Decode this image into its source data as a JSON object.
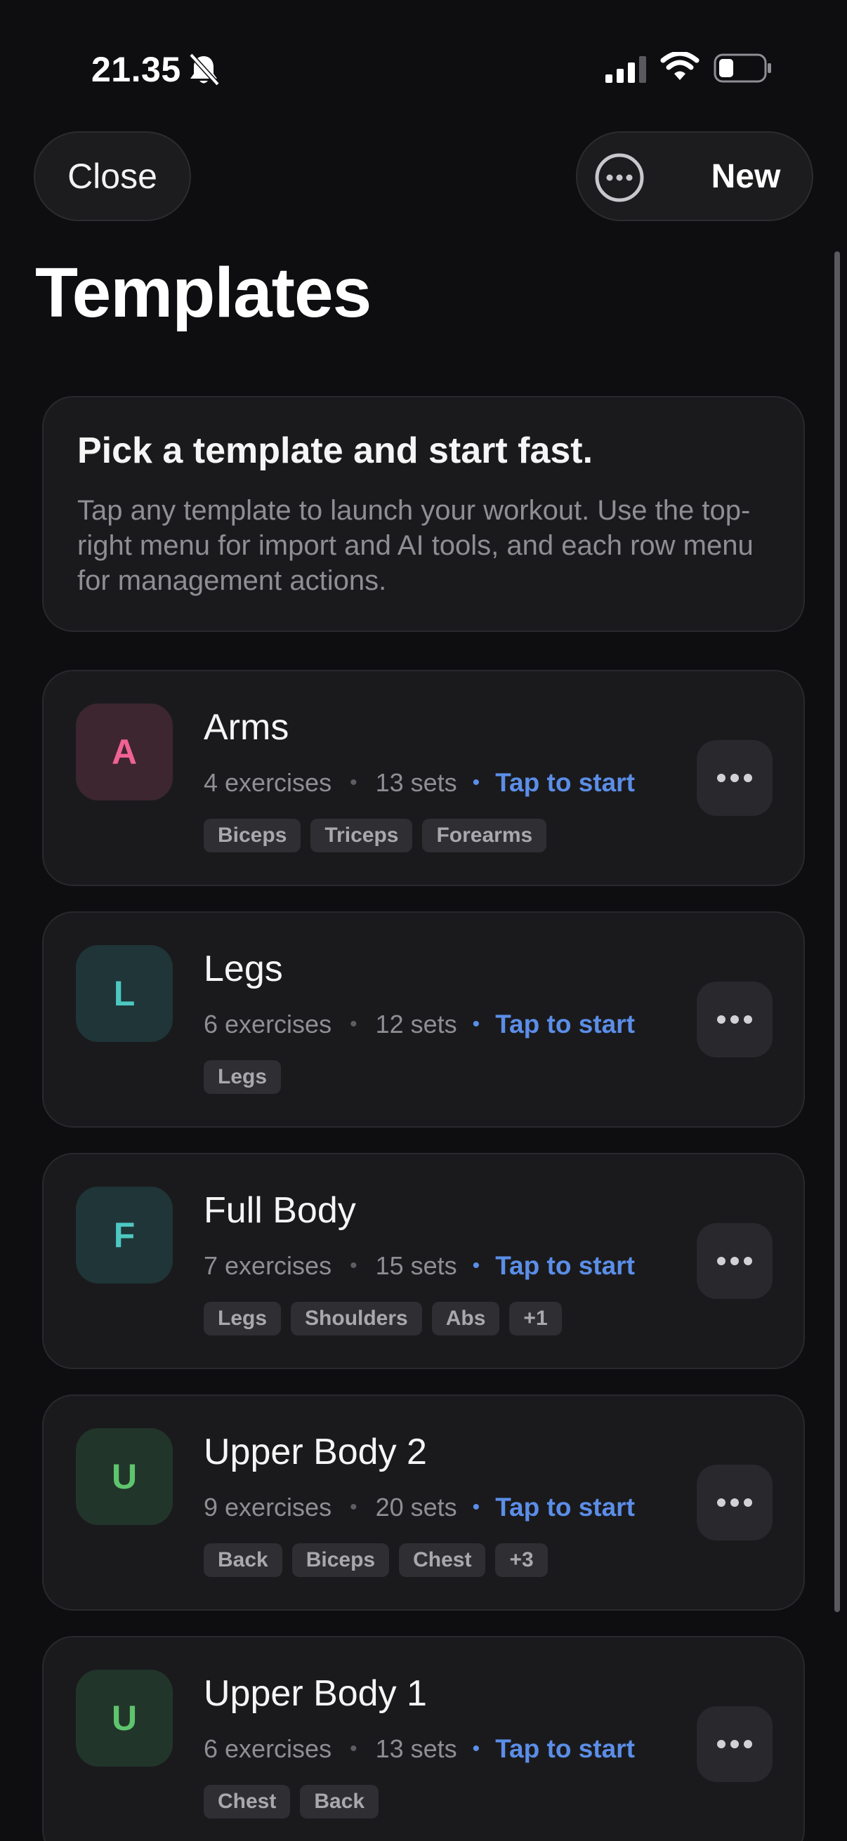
{
  "status_bar": {
    "time": "21.35"
  },
  "header": {
    "close_label": "Close",
    "new_label": "New",
    "title": "Templates"
  },
  "info": {
    "title": "Pick a template and start fast.",
    "body": "Tap any template to launch your workout. Use the top-right menu for import and AI tools, and each row menu for management actions."
  },
  "templates": [
    {
      "initial": "A",
      "name": "Arms",
      "exercises": "4 exercises",
      "sets": "13 sets",
      "action": "Tap to start",
      "tags": [
        "Biceps",
        "Triceps",
        "Forearms"
      ],
      "avatar_bg": "#3d2630",
      "avatar_fg": "#f06292"
    },
    {
      "initial": "L",
      "name": "Legs",
      "exercises": "6 exercises",
      "sets": "12 sets",
      "action": "Tap to start",
      "tags": [
        "Legs"
      ],
      "avatar_bg": "#1f3537",
      "avatar_fg": "#4dc7c2"
    },
    {
      "initial": "F",
      "name": "Full Body",
      "exercises": "7 exercises",
      "sets": "15 sets",
      "action": "Tap to start",
      "tags": [
        "Legs",
        "Shoulders",
        "Abs",
        "+1"
      ],
      "avatar_bg": "#1f3537",
      "avatar_fg": "#4dc7c2"
    },
    {
      "initial": "U",
      "name": "Upper Body 2",
      "exercises": "9 exercises",
      "sets": "20 sets",
      "action": "Tap to start",
      "tags": [
        "Back",
        "Biceps",
        "Chest",
        "+3"
      ],
      "avatar_bg": "#22352a",
      "avatar_fg": "#5ec46e"
    },
    {
      "initial": "U",
      "name": "Upper Body 1",
      "exercises": "6 exercises",
      "sets": "13 sets",
      "action": "Tap to start",
      "tags": [
        "Chest",
        "Back"
      ],
      "avatar_bg": "#22352a",
      "avatar_fg": "#5ec46e"
    }
  ],
  "icons": {
    "bell": "bell-slash-icon",
    "signal": "cellular-signal-icon",
    "wifi": "wifi-icon",
    "battery": "battery-icon",
    "more": "ellipsis-circle-icon",
    "row_menu": "ellipsis-icon"
  }
}
